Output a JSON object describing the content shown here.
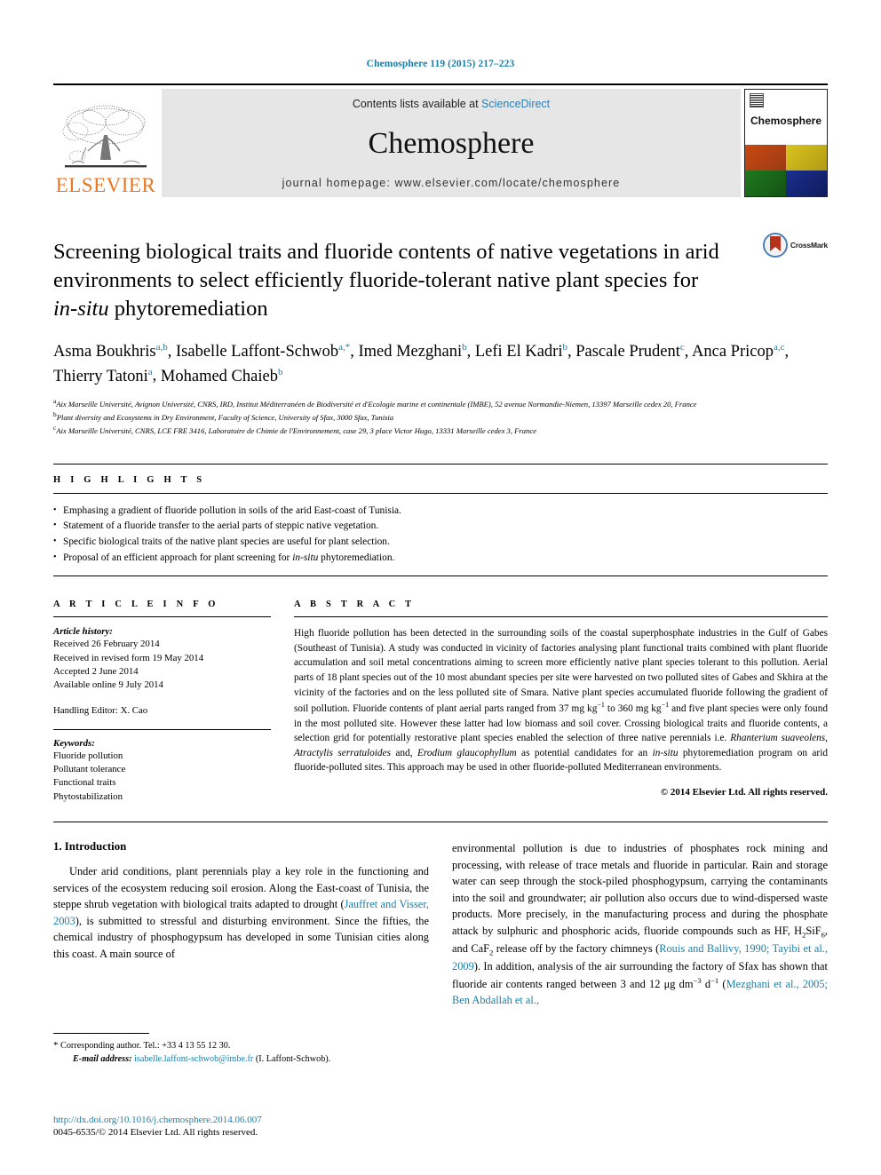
{
  "running_head": "Chemosphere 119 (2015) 217–223",
  "masthead": {
    "elsevier_wordmark": "ELSEVIER",
    "contents_prefix": "Contents lists available at ",
    "sciencedirect": "ScienceDirect",
    "journal_name": "Chemosphere",
    "homepage": "journal homepage: www.elsevier.com/locate/chemosphere",
    "cover_title": "Chemosphere"
  },
  "article": {
    "title_part1": "Screening biological traits and fluoride contents of native vegetations in arid environments to select efficiently fluoride-tolerant native plant species for ",
    "title_italic": "in-situ",
    "title_part2": " phytoremediation",
    "crossmark_label": "CrossMark",
    "authors": [
      {
        "name": "Asma Boukhris",
        "sup": "a,b",
        "sep": ", "
      },
      {
        "name": "Isabelle Laffont-Schwob",
        "sup": "a,*",
        "sep": ", "
      },
      {
        "name": "Imed Mezghani",
        "sup": "b",
        "sep": ", "
      },
      {
        "name": "Lefi El Kadri",
        "sup": "b",
        "sep": ", "
      },
      {
        "name": "Pascale Prudent",
        "sup": "c",
        "sep": ", "
      },
      {
        "name": "Anca Pricop",
        "sup": "a,c",
        "sep": ", "
      },
      {
        "name": "Thierry Tatoni",
        "sup": "a",
        "sep": ", "
      },
      {
        "name": "Mohamed Chaieb",
        "sup": "b",
        "sep": ""
      }
    ],
    "affiliations": [
      {
        "marker": "a",
        "text": "Aix Marseille Université, Avignon Université, CNRS, IRD, Institut Méditerranéen de Biodiversité et d'Ecologie marine et continentale (IMBE), 52 avenue Normandie-Niemen, 13397 Marseille cedex 20, France"
      },
      {
        "marker": "b",
        "text": "Plant diversity and Ecosystems in Dry Environment, Faculty of Science, University of Sfax, 3000 Sfax, Tunisia"
      },
      {
        "marker": "c",
        "text": "Aix Marseille Université, CNRS, LCE FRE 3416, Laboratoire de Chimie de l'Environnement, case 29, 3 place Victor Hugo, 13331 Marseille cedex 3, France"
      }
    ]
  },
  "highlights": {
    "heading": "H I G H L I G H T S",
    "items": [
      {
        "pre": "Emphasing a gradient of fluoride pollution in soils of the arid East-coast of Tunisia.",
        "italic": "",
        "post": ""
      },
      {
        "pre": "Statement of a fluoride transfer to the aerial parts of steppic native vegetation.",
        "italic": "",
        "post": ""
      },
      {
        "pre": "Specific biological traits of the native plant species are useful for plant selection.",
        "italic": "",
        "post": ""
      },
      {
        "pre": "Proposal of an efficient approach for plant screening for ",
        "italic": "in-situ",
        "post": " phytoremediation."
      }
    ]
  },
  "article_info": {
    "heading": "A R T I C L E    I N F O",
    "history_label": "Article history:",
    "history": [
      "Received 26 February 2014",
      "Received in revised form 19 May 2014",
      "Accepted 2 June 2014",
      "Available online 9 July 2014"
    ],
    "handling_editor": "Handling Editor: X. Cao",
    "keywords_label": "Keywords:",
    "keywords": [
      "Fluoride pollution",
      "Pollutant tolerance",
      "Functional traits",
      "Phytostabilization"
    ]
  },
  "abstract": {
    "heading": "A B S T R A C T",
    "p1": "High fluoride pollution has been detected in the surrounding soils of the coastal superphosphate industries in the Gulf of Gabes (Southeast of Tunisia). A study was conducted in vicinity of factories analysing plant functional traits combined with plant fluoride accumulation and soil metal concentrations aiming to screen more efficiently native plant species tolerant to this pollution. Aerial parts of 18 plant species out of the 10 most abundant species per site were harvested on two polluted sites of Gabes and Skhira at the vicinity of the factories and on the less polluted site of Smara. Native plant species accumulated fluoride following the gradient of soil pollution. Fluoride contents of plant aerial parts ranged from 37 mg kg",
    "sup1": "−1",
    "p2": " to 360 mg kg",
    "sup2": "−1",
    "p3": " and five plant species were only found in the most polluted site. However these latter had low biomass and soil cover. Crossing biological traits and fluoride contents, a selection grid for potentially restorative plant species enabled the selection of three native perennials i.e. ",
    "it1": "Rhanterium suaveolens",
    "p4": ", ",
    "it2": "Atractylis serratuloides",
    "p5": " and, ",
    "it3": "Erodium glaucophyllum",
    "p6": " as potential candidates for an ",
    "it4": "in-situ",
    "p7": " phytoremediation program on arid fluoride-polluted sites. This approach may be used in other fluoride-polluted Mediterranean environments.",
    "copyright": "© 2014 Elsevier Ltd. All rights reserved."
  },
  "introduction": {
    "heading": "1. Introduction",
    "left_p1_a": "Under arid conditions, plant perennials play a key role in the functioning and services of the ecosystem reducing soil erosion. Along the East-coast of Tunisia, the steppe shrub vegetation with biological traits adapted to drought (",
    "left_cite1": "Jauffret and Visser, 2003",
    "left_p1_b": "), is submitted to stressful and disturbing environment. Since the fifties, the chemical industry of phosphogypsum has developed in some Tunisian cities along this coast. A main source of",
    "right_p1_a": "environmental pollution is due to industries of phosphates rock mining and processing, with release of trace metals and fluoride in particular. Rain and storage water can seep through the stock-piled phosphogypsum, carrying the contaminants into the soil and groundwater; air pollution also occurs due to wind-dispersed waste products. More precisely, in the manufacturing process and during the phosphate attack by sulphuric and phosphoric acids, fluoride compounds such as HF, H",
    "right_sub1": "2",
    "right_p1_b": "SiF",
    "right_sub2": "6",
    "right_p1_c": ", and CaF",
    "right_sub3": "2",
    "right_p1_d": " release off by the factory chimneys (",
    "right_cite1": "Rouis and Ballivy, 1990; Tayibi et al., 2009",
    "right_p1_e": "). In addition, analysis of the air surrounding the factory of Sfax has shown that fluoride air contents ranged between 3 and 12 μg dm",
    "right_sup1": "−3",
    "right_p1_f": " d",
    "right_sup2": "−1",
    "right_p1_g": " (",
    "right_cite2": "Mezghani et al., 2005; Ben Abdallah et al.,",
    "right_p1_h": ""
  },
  "footer": {
    "corresponding_star": "*",
    "corresponding_text": "Corresponding author. Tel.: +33 4 13 55 12 30.",
    "email_label": "E-mail address:",
    "email": "isabelle.laffont-schwob@imbe.fr",
    "email_owner": "(I. Laffont-Schwob).",
    "doi": "http://dx.doi.org/10.1016/j.chemosphere.2014.06.007",
    "issn": "0045-6535/© 2014 Elsevier Ltd. All rights reserved."
  },
  "colors": {
    "link": "#1a7fa8",
    "elsevier_orange": "#E87722",
    "band_gray": "#e6e6e6"
  }
}
